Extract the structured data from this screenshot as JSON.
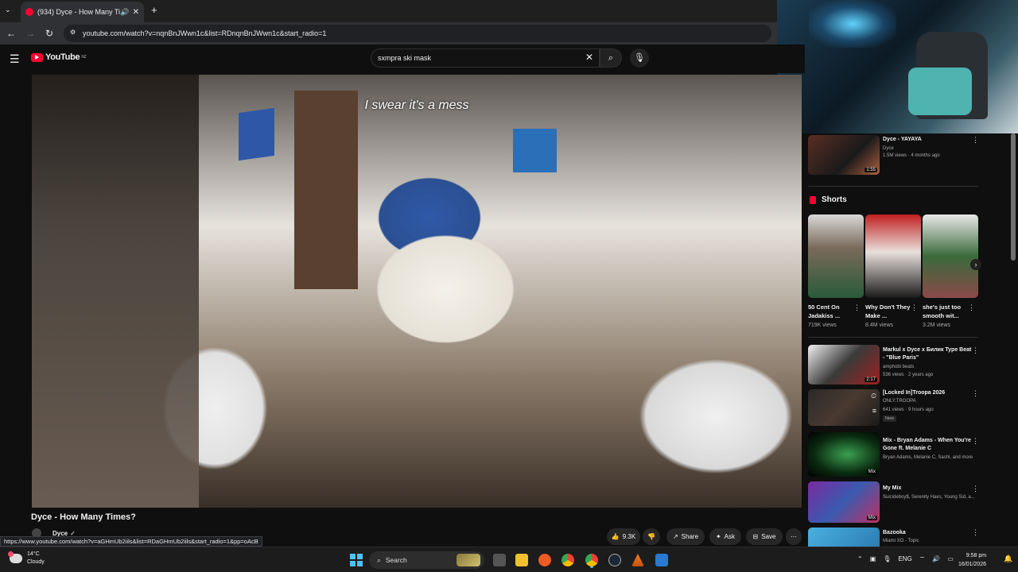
{
  "browser": {
    "tab_title": "(934) Dyce - How Many Tim",
    "url": "youtube.com/watch?v=nqnBnJWwn1c&list=RDnqnBnJWwn1c&start_radio=1",
    "status_url": "https://www.youtube.com/watch?v=aGHmUb2iils&list=RDaGHmUb2iils&start_radio=1&pp=oAcB"
  },
  "youtube": {
    "logo_text": "YouTube",
    "region": "NZ",
    "search_value": "sxmpra ski mask"
  },
  "video": {
    "subtitle": "I swear it's a mess",
    "title": "Dyce - How Many Times?",
    "channel": "Dyce",
    "likes": "9.3K",
    "share_label": "Share",
    "ask_label": "Ask",
    "save_label": "Save"
  },
  "sidebar": {
    "top_video": {
      "title": "Dyce - YAYAYA",
      "channel": "Dyce",
      "meta": "1.5M views · 4 months ago",
      "duration": "1:55"
    },
    "shorts_heading": "Shorts",
    "shorts": [
      {
        "title": "50 Cent On Jadakiss ...",
        "views": "719K views"
      },
      {
        "title": "Why Don't They Make ...",
        "views": "8.4M views"
      },
      {
        "title": "she's just too smooth wit...",
        "views": "3.2M views"
      }
    ],
    "videos": [
      {
        "title": "Markul x Dyce x Билик Type Beat - \"Blue Paris\"",
        "channel": "amphobi beats",
        "meta": "536 views · 2 years ago",
        "duration": "2:17"
      },
      {
        "title": "[Locked In]Troopa 2026",
        "channel": "ONLY.TROOPA",
        "meta": "641 views · 9 hours ago",
        "badge": "New"
      },
      {
        "title": "Mix - Bryan Adams - When You're Gone ft. Melanie C",
        "channel": "Bryan Adams, Melanie C, Sashl, and more",
        "duration": "Mix"
      },
      {
        "title": "My Mix",
        "channel": "Suicideboy$, Serenity Haes, Young Sid, a...",
        "duration": "Mix"
      },
      {
        "title": "Bazooka",
        "channel": "Miami XO - Topic"
      }
    ]
  },
  "taskbar": {
    "temp": "14°C",
    "weather": "Cloudy",
    "search_label": "Search",
    "lang": "ENG",
    "time": "9:58 pm",
    "date": "16/01/2026"
  },
  "colors": {
    "accent": "#ff0033",
    "background": "#0f0f0f"
  }
}
